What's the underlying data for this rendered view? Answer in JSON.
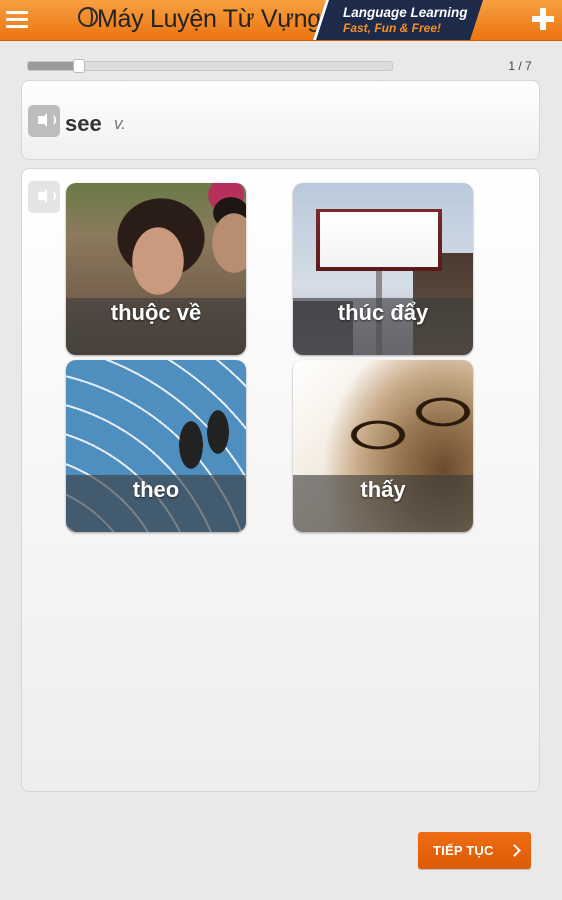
{
  "header": {
    "app_title": "Máy Luyện Từ Vựng",
    "badge_line1": "Language Learning",
    "badge_line2": "Fast, Fun & Free!",
    "accent_color": "#ec7412",
    "badge_color": "#1e2a4a"
  },
  "progress": {
    "current": 1,
    "total": 7,
    "label": "1 / 7",
    "fraction": 0.14
  },
  "prompt": {
    "word": "see",
    "part_of_speech": "v."
  },
  "choices": [
    {
      "label": "thuộc về"
    },
    {
      "label": "thúc đẩy"
    },
    {
      "label": "theo"
    },
    {
      "label": "thấy"
    }
  ],
  "actions": {
    "continue_label": "TIẾP TỤC",
    "continue_color": "#e8630a"
  }
}
